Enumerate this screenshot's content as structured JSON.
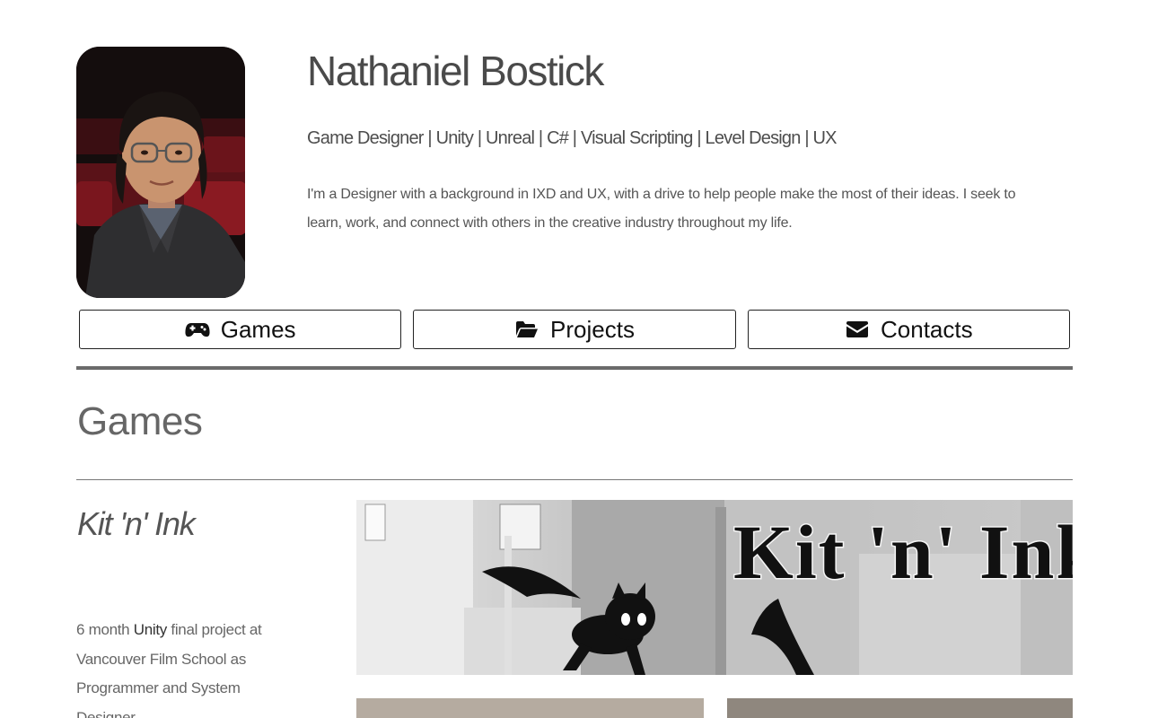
{
  "profile": {
    "name": "Nathaniel Bostick",
    "tagline": "Game Designer | Unity | Unreal | C# | Visual Scripting | Level Design | UX",
    "bio": "I'm a Designer with a background in IXD and UX, with a drive to help people make the most of their ideas. I seek to learn, work, and connect with others in the creative industry throughout my life."
  },
  "nav": {
    "items": [
      {
        "label": "Games",
        "icon": "gamepad-icon"
      },
      {
        "label": "Projects",
        "icon": "folder-open-icon"
      },
      {
        "label": "Contacts",
        "icon": "envelope-icon"
      }
    ]
  },
  "section": {
    "title": "Games"
  },
  "games": [
    {
      "title": "Kit 'n' Ink",
      "banner_text": "Kit 'n' Ink",
      "desc_prefix": "6 month ",
      "desc_strong": "Unity",
      "desc_suffix": " final project at Vancouver Film School as Programmer and System Designer"
    }
  ],
  "colors": {
    "text": "#444444",
    "rule": "#6b6b6b",
    "border": "#222222"
  }
}
